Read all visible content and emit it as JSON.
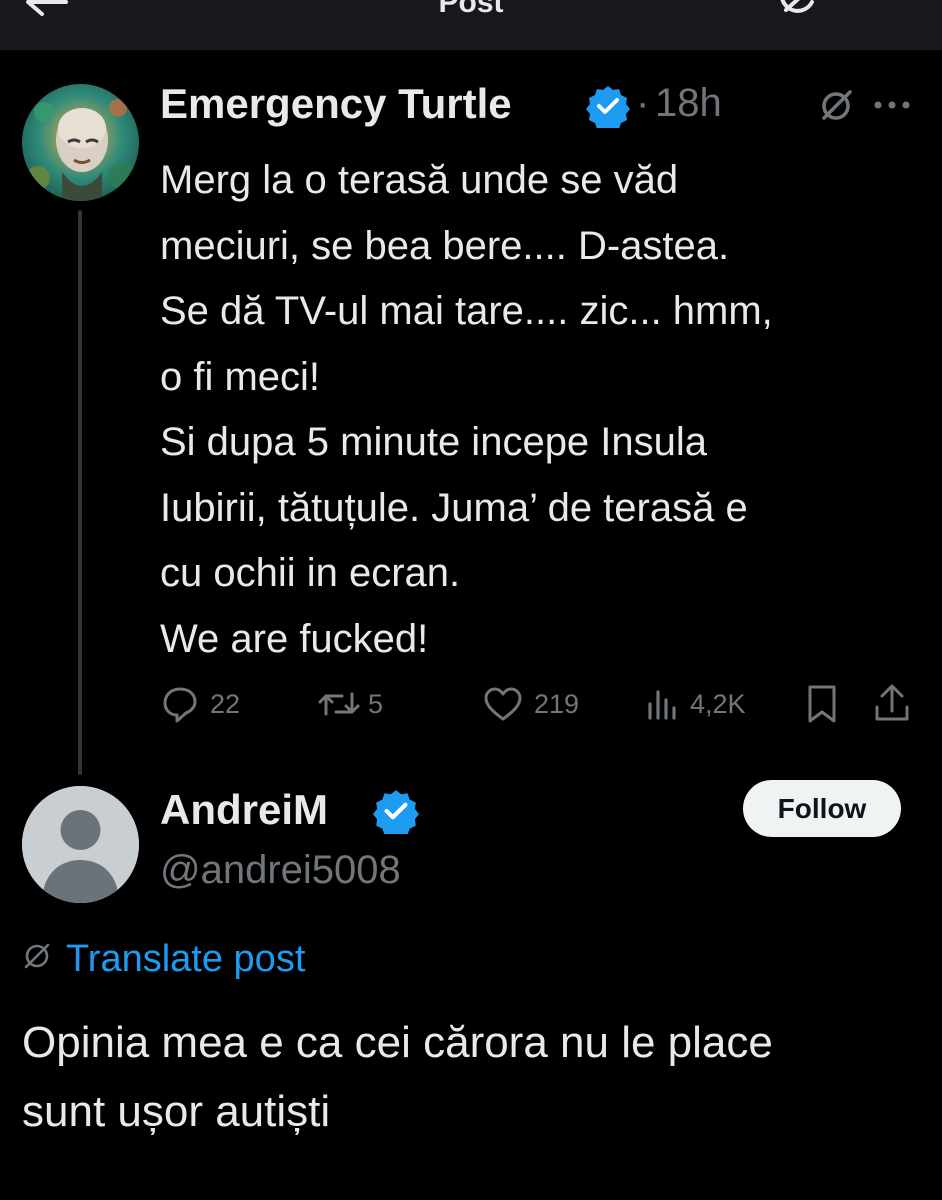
{
  "header": {
    "title": "Post"
  },
  "original_post": {
    "author_name": "Emergency Turtle",
    "separator": "·",
    "time": "18h",
    "text_lines": [
      "Merg la o terasă unde se văd",
      "meciuri, se bea bere.... D-astea.",
      "Se dă TV-ul mai tare.... zic... hmm,",
      "o fi meci!",
      "Si dupa 5 minute incepe Insula",
      "Iubirii, tătuțule. Juma’ de terasă e",
      "cu ochii in ecran.",
      "We are fucked!"
    ],
    "actions": {
      "replies": "22",
      "reposts": "5",
      "likes": "219",
      "views": "4,2K"
    }
  },
  "reply_post": {
    "author_name": "AndreiM",
    "handle": "@andrei5008",
    "follow_label": "Follow",
    "translate_label": "Translate post",
    "text_lines": [
      "Opinia mea e ca cei cărora nu le place",
      "sunt ușor autiști"
    ]
  },
  "colors": {
    "background": "#000000",
    "text": "#e7e9ea",
    "muted": "#71767b",
    "accent": "#1d9bf0",
    "verified": "#1d9bf0"
  },
  "icons": [
    "back-arrow-icon",
    "refresh-icon",
    "more-icon",
    "verified-badge-icon",
    "grok-icon",
    "reply-icon",
    "repost-icon",
    "like-icon",
    "views-icon",
    "bookmark-icon",
    "share-icon",
    "globe-icon"
  ]
}
